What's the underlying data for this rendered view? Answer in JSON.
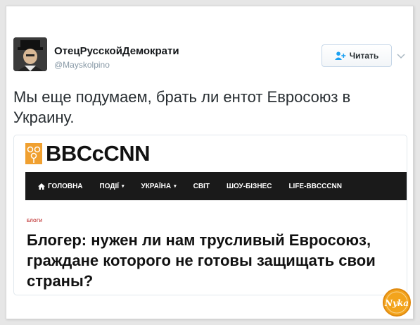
{
  "tweet": {
    "display_name": "ОтецРусскойДемократи",
    "handle": "@Mayskolpino",
    "follow_label": "Читать",
    "text": "Мы еще подумаем, брать ли ентот Евросоюз в Украину."
  },
  "embed": {
    "logo_text": "BBCcCNN",
    "nav": [
      {
        "label": "ГОЛОВНА",
        "icon": "home-icon",
        "dropdown": false
      },
      {
        "label": "ПОДІЇ",
        "dropdown": true
      },
      {
        "label": "УКРАЇНА",
        "dropdown": true
      },
      {
        "label": "СВІТ",
        "dropdown": false
      },
      {
        "label": "ШОУ-БІЗНЕС",
        "dropdown": false
      },
      {
        "label": "LIFE-BBCCCNN",
        "dropdown": false
      }
    ],
    "section_label": "БЛОГИ",
    "headline": "Блогер: нужен ли нам трусливый Евросоюз, граждане которого не готовы защищать свои страны?"
  },
  "watermark": {
    "text": "Nyka"
  },
  "colors": {
    "nav_bg": "#1a1a1a",
    "logo_orange": "#f0a030",
    "follow_border": "#c6d7e8",
    "watermark_orange": "#f3a41c"
  }
}
